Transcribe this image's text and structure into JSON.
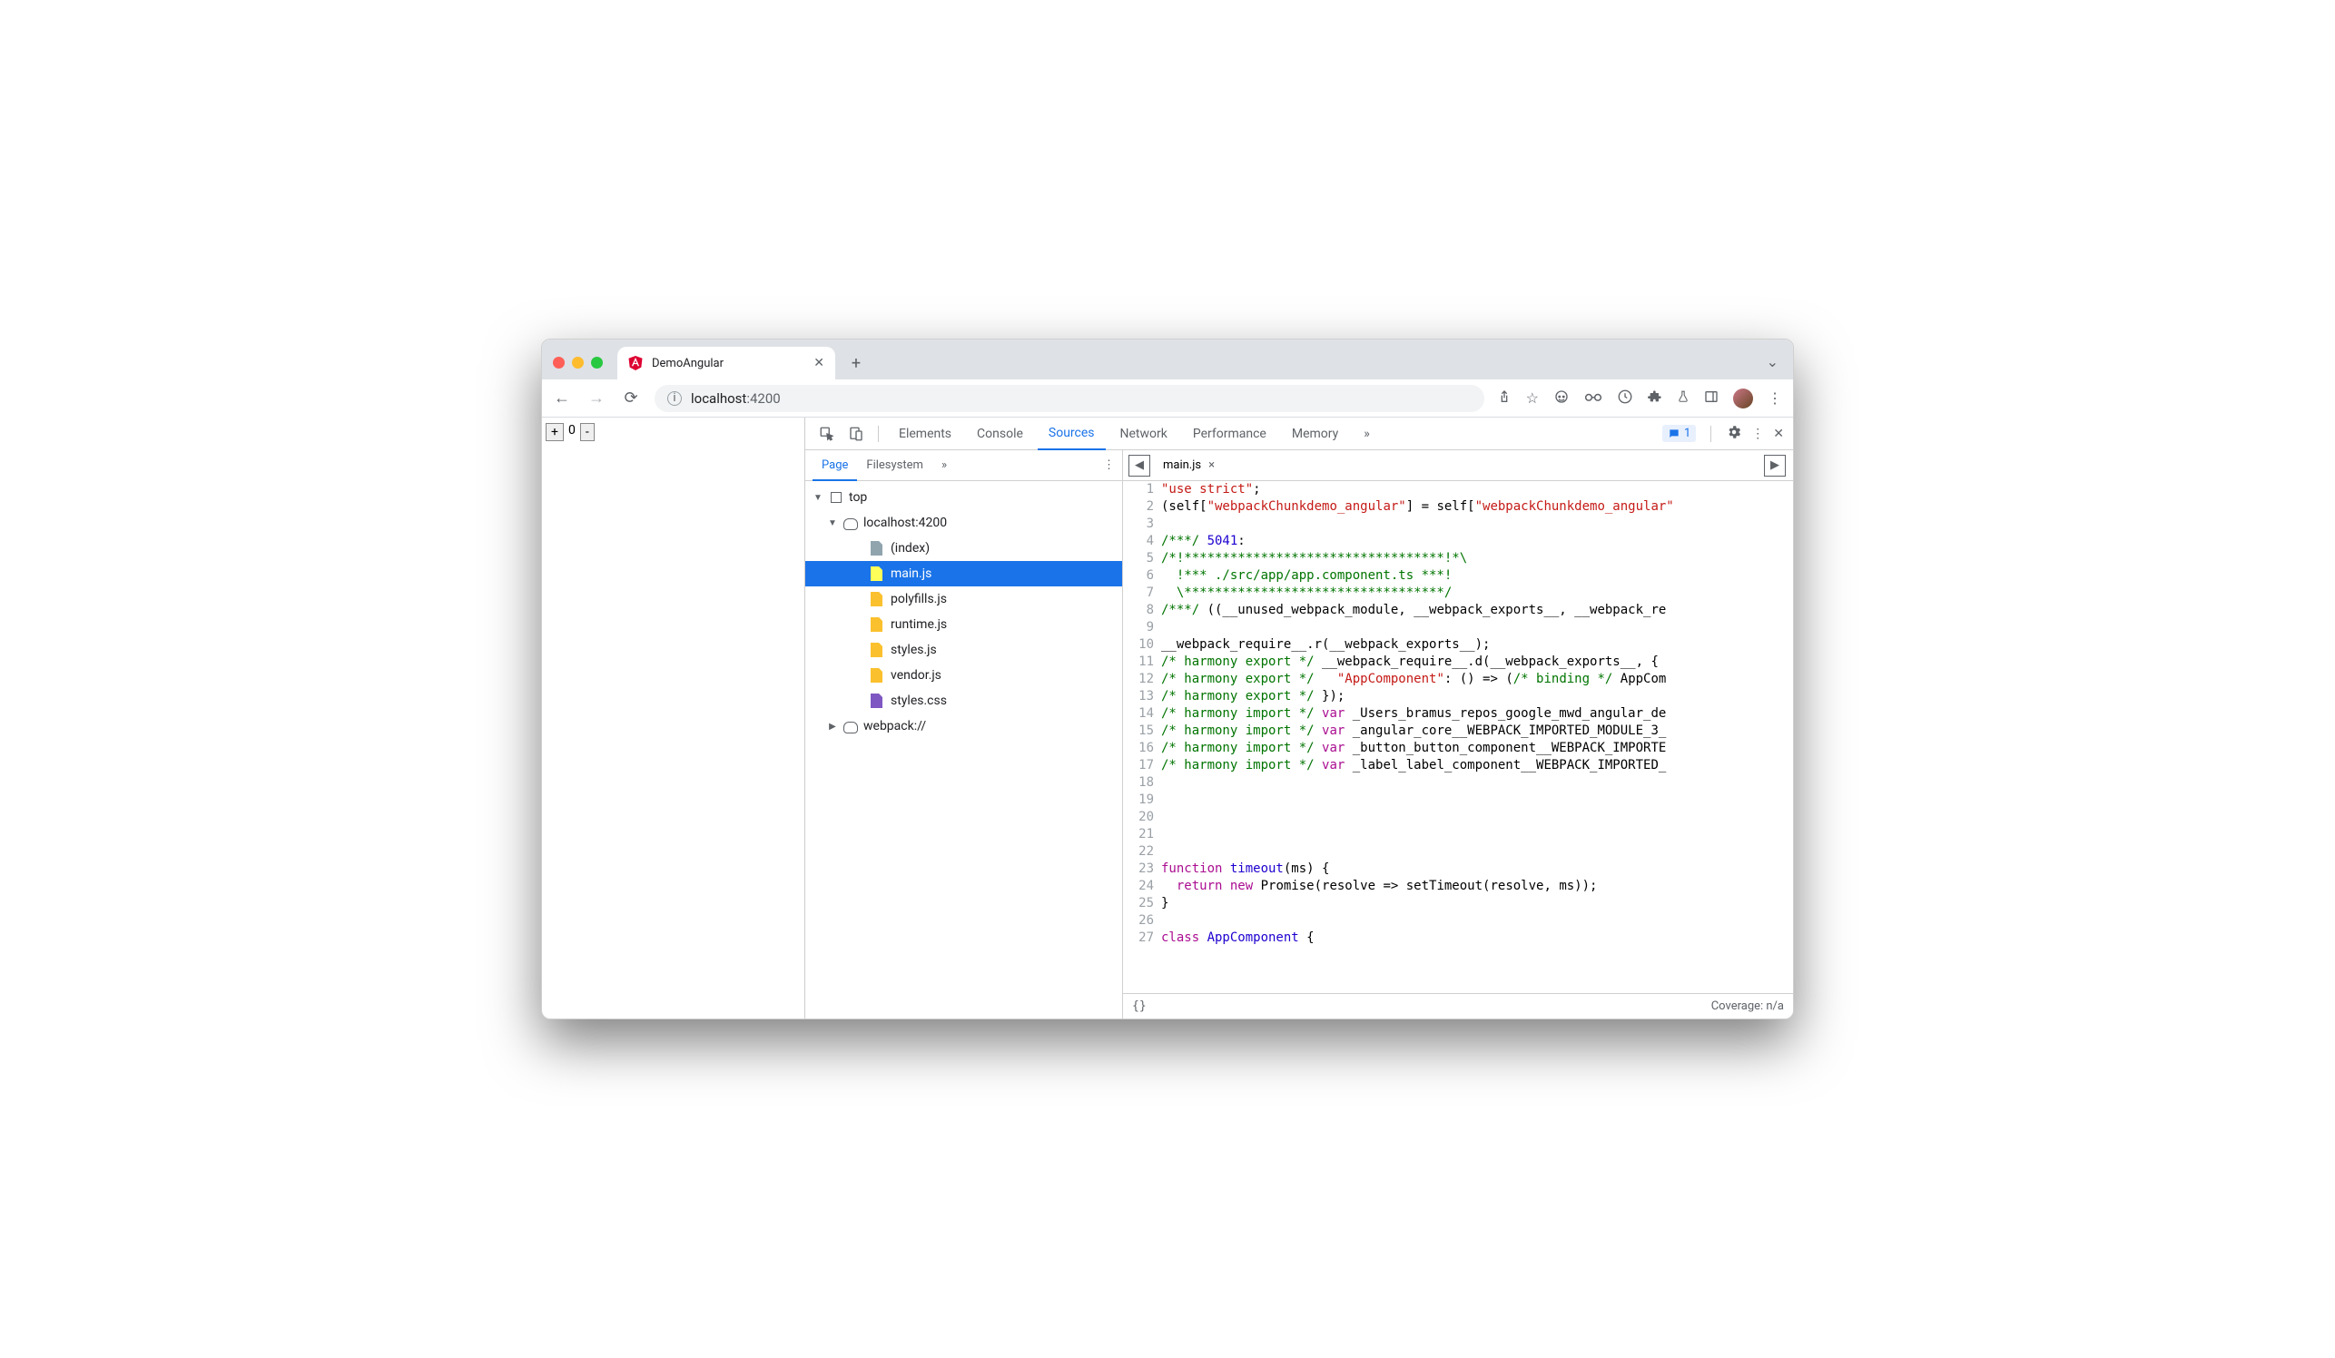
{
  "browser": {
    "tab_title": "DemoAngular",
    "url_host": "localhost",
    "url_port": ":4200"
  },
  "page": {
    "plus": "+",
    "value": "0",
    "minus": "-"
  },
  "devtools": {
    "tabs": [
      "Elements",
      "Console",
      "Sources",
      "Network",
      "Performance",
      "Memory"
    ],
    "active_tab": "Sources",
    "overflow": "»",
    "issues_count": "1"
  },
  "nav": {
    "tabs": [
      "Page",
      "Filesystem"
    ],
    "active": "Page",
    "overflow": "»",
    "tree": [
      {
        "label": "top",
        "depth": 0,
        "kind": "frame",
        "expand": "▼"
      },
      {
        "label": "localhost:4200",
        "depth": 1,
        "kind": "cloud",
        "expand": "▼"
      },
      {
        "label": "(index)",
        "depth": 2,
        "kind": "doc"
      },
      {
        "label": "main.js",
        "depth": 2,
        "kind": "js",
        "selected": true
      },
      {
        "label": "polyfills.js",
        "depth": 2,
        "kind": "js"
      },
      {
        "label": "runtime.js",
        "depth": 2,
        "kind": "js"
      },
      {
        "label": "styles.js",
        "depth": 2,
        "kind": "js"
      },
      {
        "label": "vendor.js",
        "depth": 2,
        "kind": "js"
      },
      {
        "label": "styles.css",
        "depth": 2,
        "kind": "css"
      },
      {
        "label": "webpack://",
        "depth": 1,
        "kind": "cloud",
        "expand": "▶"
      }
    ]
  },
  "editor": {
    "open_file": "main.js",
    "close": "×",
    "lines": [
      [
        {
          "t": "\"use strict\"",
          "c": "str"
        },
        {
          "t": ";"
        }
      ],
      [
        {
          "t": "(self["
        },
        {
          "t": "\"webpackChunkdemo_angular\"",
          "c": "str"
        },
        {
          "t": "] = self["
        },
        {
          "t": "\"webpackChunkdemo_angular\"",
          "c": "str"
        }
      ],
      [],
      [
        {
          "t": "/***/ ",
          "c": "com"
        },
        {
          "t": "5041",
          "c": "idx"
        },
        {
          "t": ":"
        }
      ],
      [
        {
          "t": "/*!**********************************!*\\",
          "c": "com"
        }
      ],
      [
        {
          "t": "  !*** ./src/app/app.component.ts ***!",
          "c": "com"
        }
      ],
      [
        {
          "t": "  \\**********************************/",
          "c": "com"
        }
      ],
      [
        {
          "t": "/***/ ",
          "c": "com"
        },
        {
          "t": "((__unused_webpack_module, __webpack_exports__, __webpack_re"
        }
      ],
      [],
      [
        {
          "t": "__webpack_require__.r(__webpack_exports__);"
        }
      ],
      [
        {
          "t": "/* harmony export */ ",
          "c": "com"
        },
        {
          "t": "__webpack_require__.d(__webpack_exports__, {"
        }
      ],
      [
        {
          "t": "/* harmony export */   ",
          "c": "com"
        },
        {
          "t": "\"AppComponent\"",
          "c": "str"
        },
        {
          "t": ": () => ("
        },
        {
          "t": "/* binding */ ",
          "c": "com"
        },
        {
          "t": "AppCom"
        }
      ],
      [
        {
          "t": "/* harmony export */ ",
          "c": "com"
        },
        {
          "t": "});"
        }
      ],
      [
        {
          "t": "/* harmony import */ ",
          "c": "com"
        },
        {
          "t": "var ",
          "c": "kw"
        },
        {
          "t": "_Users_bramus_repos_google_mwd_angular_de"
        }
      ],
      [
        {
          "t": "/* harmony import */ ",
          "c": "com"
        },
        {
          "t": "var ",
          "c": "kw"
        },
        {
          "t": "_angular_core__WEBPACK_IMPORTED_MODULE_3_"
        }
      ],
      [
        {
          "t": "/* harmony import */ ",
          "c": "com"
        },
        {
          "t": "var ",
          "c": "kw"
        },
        {
          "t": "_button_button_component__WEBPACK_IMPORTE"
        }
      ],
      [
        {
          "t": "/* harmony import */ ",
          "c": "com"
        },
        {
          "t": "var ",
          "c": "kw"
        },
        {
          "t": "_label_label_component__WEBPACK_IMPORTED_"
        }
      ],
      [],
      [],
      [],
      [],
      [],
      [
        {
          "t": "function ",
          "c": "kw"
        },
        {
          "t": "timeout",
          "c": "fn"
        },
        {
          "t": "(ms) {"
        }
      ],
      [
        {
          "t": "  "
        },
        {
          "t": "return ",
          "c": "kw"
        },
        {
          "t": "new ",
          "c": "kw"
        },
        {
          "t": "Promise(resolve => setTimeout(resolve, ms));"
        }
      ],
      [
        {
          "t": "}"
        }
      ],
      [],
      [
        {
          "t": "class ",
          "c": "kw"
        },
        {
          "t": "AppComponent",
          "c": "fn"
        },
        {
          "t": " {"
        }
      ]
    ]
  },
  "status": {
    "pretty": "{}",
    "coverage": "Coverage: n/a"
  }
}
